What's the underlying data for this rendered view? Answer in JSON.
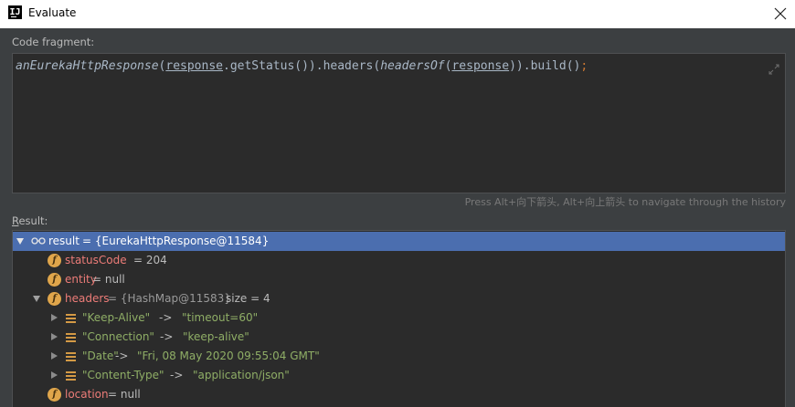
{
  "window": {
    "title": "Evaluate",
    "app_icon_text": "IJ"
  },
  "code_fragment": {
    "label": "Code fragment:",
    "tokens": {
      "t1": "anEurekaHttpResponse",
      "t2": "(",
      "t3": "response",
      "t4": ".getStatus()).headers(",
      "t5": "headersOf",
      "t6": "(",
      "t7": "response",
      "t8": ")).build()",
      "t9": ";"
    }
  },
  "history_hint": "Press Alt+向下箭头, Alt+向上箭头 to navigate through the history",
  "result": {
    "label_first": "R",
    "label_rest": "esult:",
    "root": {
      "name": "result",
      "value": " = {EurekaHttpResponse@11584}"
    },
    "fields": [
      {
        "name": "statusCode",
        "value": " = 204"
      },
      {
        "name": "entity",
        "value": " = null"
      },
      {
        "name": "headers",
        "value": " = {HashMap@11583}",
        "extra": "  size = 4"
      },
      {
        "name": "location",
        "value": " = null"
      }
    ],
    "entries": [
      {
        "key": "\"Keep-Alive\"",
        "arrow": " -> ",
        "value": "\"timeout=60\""
      },
      {
        "key": "\"Connection\"",
        "arrow": " -> ",
        "value": "\"keep-alive\""
      },
      {
        "key": "\"Date\"",
        "arrow": " -> ",
        "value": "\"Fri, 08 May 2020 09:55:04 GMT\""
      },
      {
        "key": "\"Content-Type\"",
        "arrow": " -> ",
        "value": "\"application/json\""
      }
    ]
  },
  "icons": {
    "app": "intellij-icon",
    "close": "close-icon",
    "expand": "expand-editor-icon",
    "watch": "watch-glasses-icon",
    "field": "field-f-icon",
    "entry": "map-entry-icon"
  },
  "colors": {
    "background": "#3c3f41",
    "editor": "#2b2b2b",
    "selection": "#4b6eaf",
    "field_name": "#ed7c78",
    "string_value": "#8fae66",
    "field_icon": "#e0a64b"
  }
}
